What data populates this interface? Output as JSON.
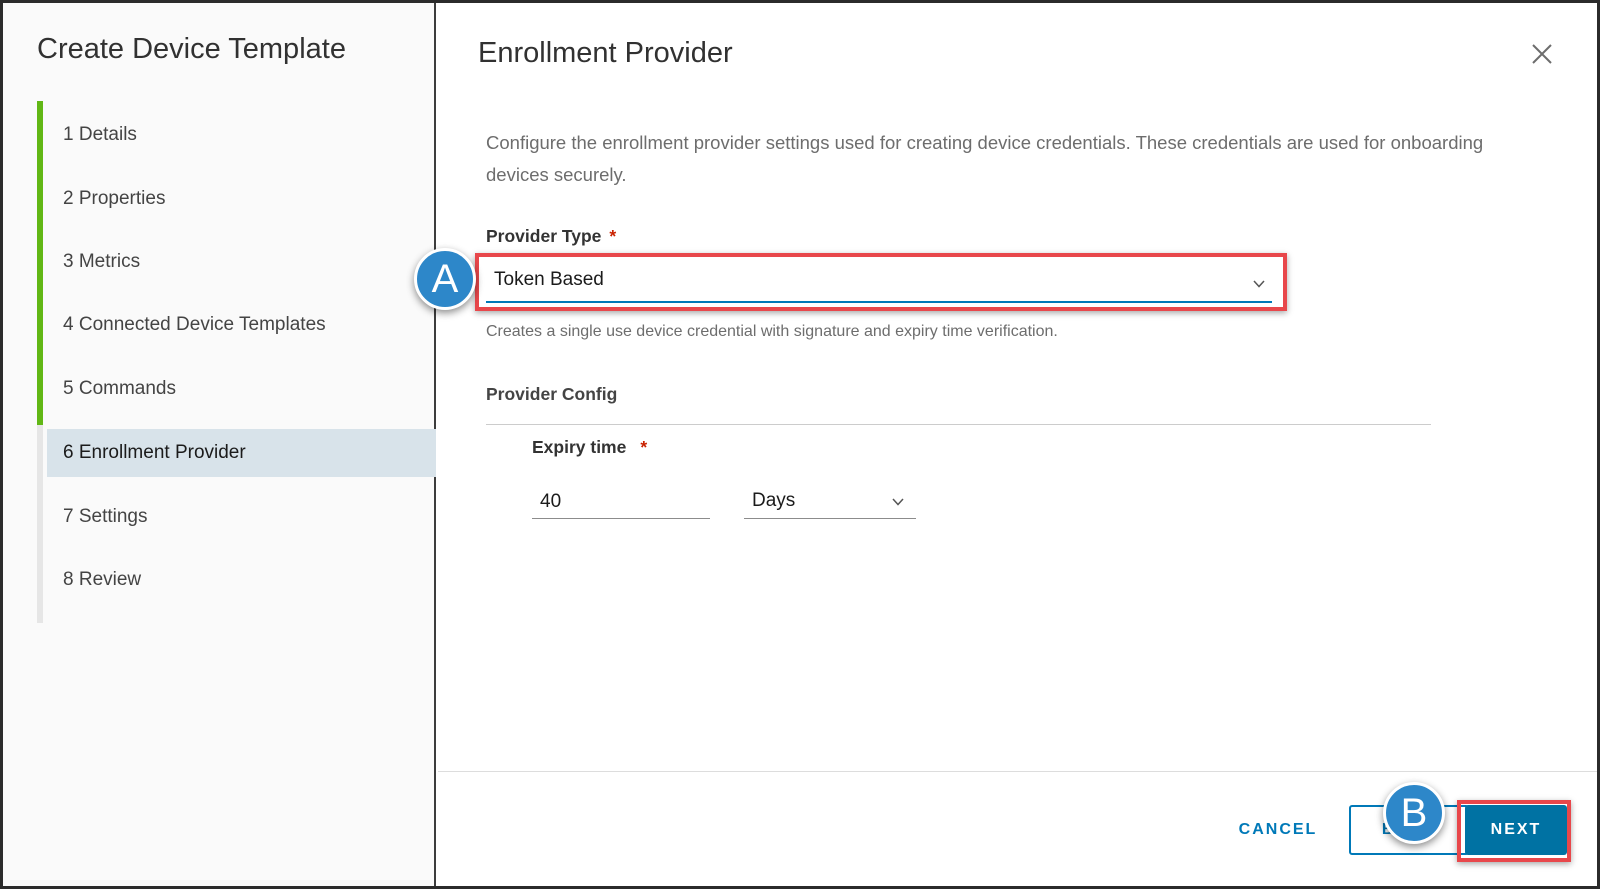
{
  "sidebar": {
    "title": "Create Device Template",
    "steps": [
      {
        "label": "1  Details"
      },
      {
        "label": "2  Properties"
      },
      {
        "label": "3  Metrics"
      },
      {
        "label": "4  Connected Device Templates"
      },
      {
        "label": "5  Commands"
      },
      {
        "label": "6  Enrollment Provider"
      },
      {
        "label": "7  Settings"
      },
      {
        "label": "8  Review"
      }
    ],
    "active_step": "6  Enrollment Provider",
    "completed_color": "#61b715"
  },
  "main": {
    "title": "Enrollment Provider",
    "close_icon": "close-icon",
    "description": "Configure the enrollment provider settings used for creating device credentials. These credentials are used for onboarding devices securely.",
    "provider_type": {
      "label": "Provider Type",
      "required_mark": "*",
      "value": "Token Based",
      "helper": "Creates a single use device credential with signature and expiry time verification."
    },
    "provider_config": {
      "title": "Provider Config",
      "expiry": {
        "label": "Expiry time",
        "required_mark": "*",
        "value": "40",
        "unit": "Days"
      }
    }
  },
  "footer": {
    "cancel_label": "CANCEL",
    "back_label": "BACK",
    "next_label": "NEXT"
  },
  "annotations": {
    "a_label": "A",
    "b_label": "B",
    "highlight_color": "#e8474b",
    "badge_color": "#2d87c9"
  },
  "colors": {
    "primary": "#0079b8",
    "required": "#c92100"
  }
}
